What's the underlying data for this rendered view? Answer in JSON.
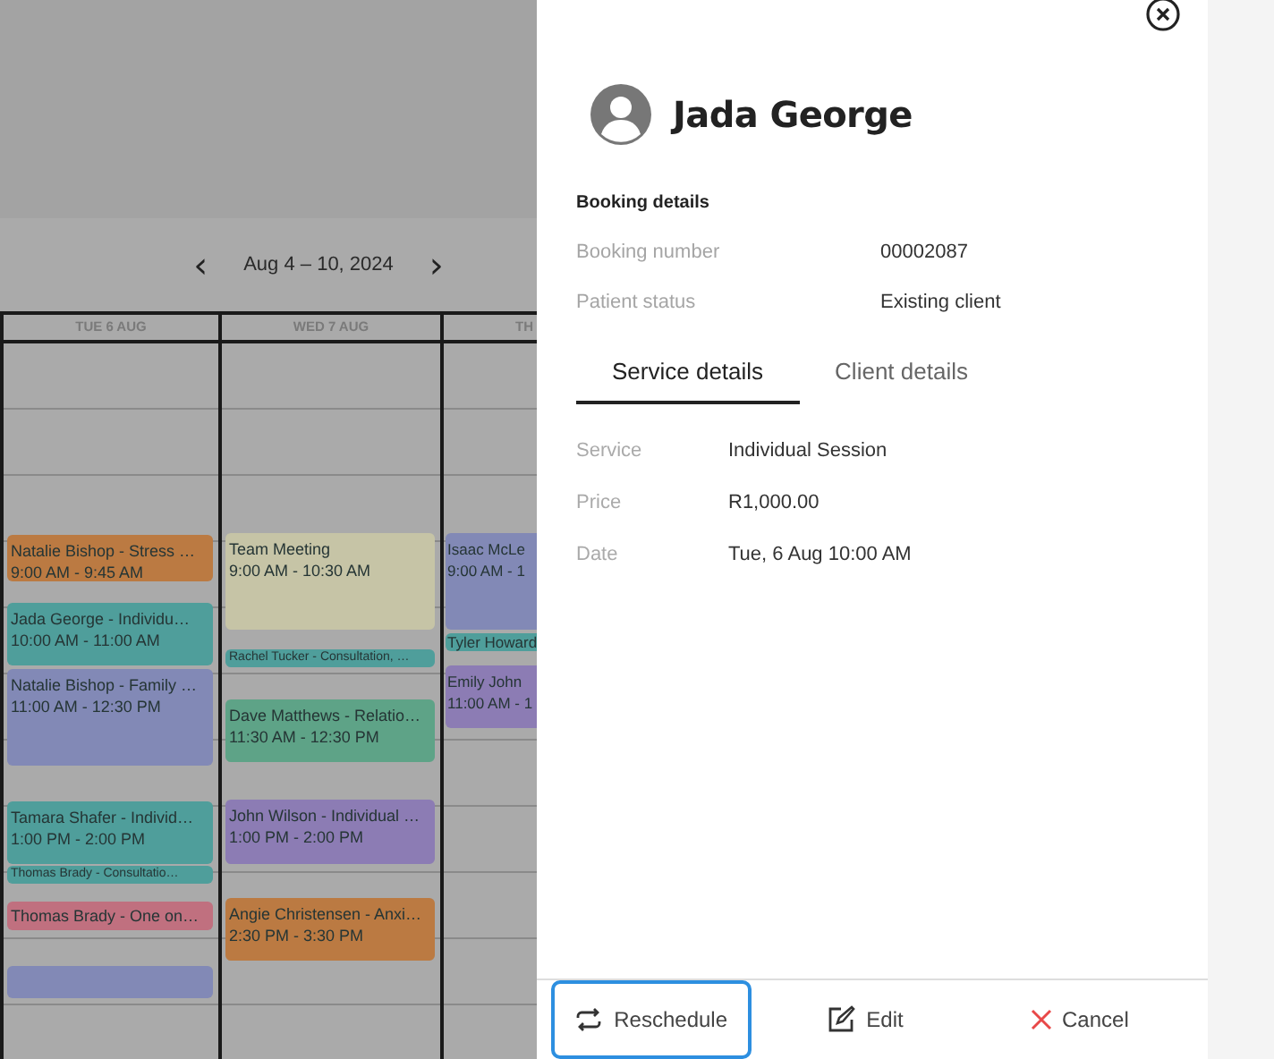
{
  "calendar": {
    "range": "Aug 4 – 10, 2024",
    "prev_icon": "‹",
    "next_icon": "›",
    "days": [
      {
        "label": "TUE 6 AUG",
        "events": [
          {
            "kind": "full",
            "title": "Natalie Bishop - Stress …",
            "time": "9:00 AM - 9:45 AM",
            "color": "#bb7a42"
          },
          {
            "kind": "full",
            "title": "Jada George - Individu…",
            "time": "10:00 AM - 11:00 AM",
            "color": "#4f9e9b"
          },
          {
            "kind": "full",
            "title": "Natalie Bishop - Family …",
            "time": "11:00 AM - 12:30 PM",
            "color": "#8289b6"
          },
          {
            "kind": "full",
            "title": "Tamara Shafer - Individ…",
            "time": "1:00 PM - 2:00 PM",
            "color": "#4f9e9b"
          },
          {
            "kind": "mini",
            "title": "Thomas Brady - Consultatio…",
            "color": "#4f9e9b"
          },
          {
            "kind": "title",
            "title": "Thomas Brady - One on…",
            "color": "#c0707f"
          },
          {
            "kind": "blank",
            "color": "#8289b6"
          }
        ]
      },
      {
        "label": "WED 7 AUG",
        "events": [
          {
            "kind": "full",
            "title": "Team Meeting",
            "time": "9:00 AM - 10:30 AM",
            "color": "#c6c4a6"
          },
          {
            "kind": "mini",
            "title": "Rachel Tucker - Consultation, …",
            "color": "#4f9e9b"
          },
          {
            "kind": "full",
            "title": "Dave Matthews - Relatio…",
            "time": "11:30 AM - 12:30 PM",
            "color": "#5ea387"
          },
          {
            "kind": "full",
            "title": "John Wilson - Individual …",
            "time": "1:00 PM - 2:00 PM",
            "color": "#8c7cb4"
          },
          {
            "kind": "full",
            "title": "Angie Christensen - Anxi…",
            "time": "2:30 PM - 3:30 PM",
            "color": "#bb7a42"
          }
        ]
      },
      {
        "label": "TH",
        "events": [
          {
            "kind": "full",
            "title": "Isaac McLe",
            "time": "9:00 AM - 1",
            "color": "#8289b6"
          },
          {
            "kind": "mini",
            "title": "Tyler Howard",
            "color": "#4f9e9b"
          },
          {
            "kind": "full",
            "title": "Emily John",
            "time": "11:00 AM - 1",
            "color": "#8c7cb4"
          }
        ]
      }
    ]
  },
  "drawer": {
    "name": "Jada George",
    "section_title": "Booking details",
    "booking_rows": [
      {
        "label": "Booking number",
        "value": "00002087"
      },
      {
        "label": "Patient status",
        "value": "Existing client"
      }
    ],
    "tabs": [
      {
        "label": "Service details",
        "selected": true
      },
      {
        "label": "Client details",
        "selected": false
      }
    ],
    "service_rows": [
      {
        "label": "Service",
        "value": "Individual Session"
      },
      {
        "label": "Price",
        "value": "R1,000.00"
      },
      {
        "label": "Date",
        "value": "Tue, 6 Aug 10:00 AM"
      }
    ],
    "actions": [
      {
        "kind": "reschedule",
        "label": "Reschedule",
        "focused": true
      },
      {
        "kind": "edit",
        "label": "Edit",
        "focused": false
      },
      {
        "kind": "cancel",
        "label": "Cancel",
        "focused": false
      }
    ]
  }
}
